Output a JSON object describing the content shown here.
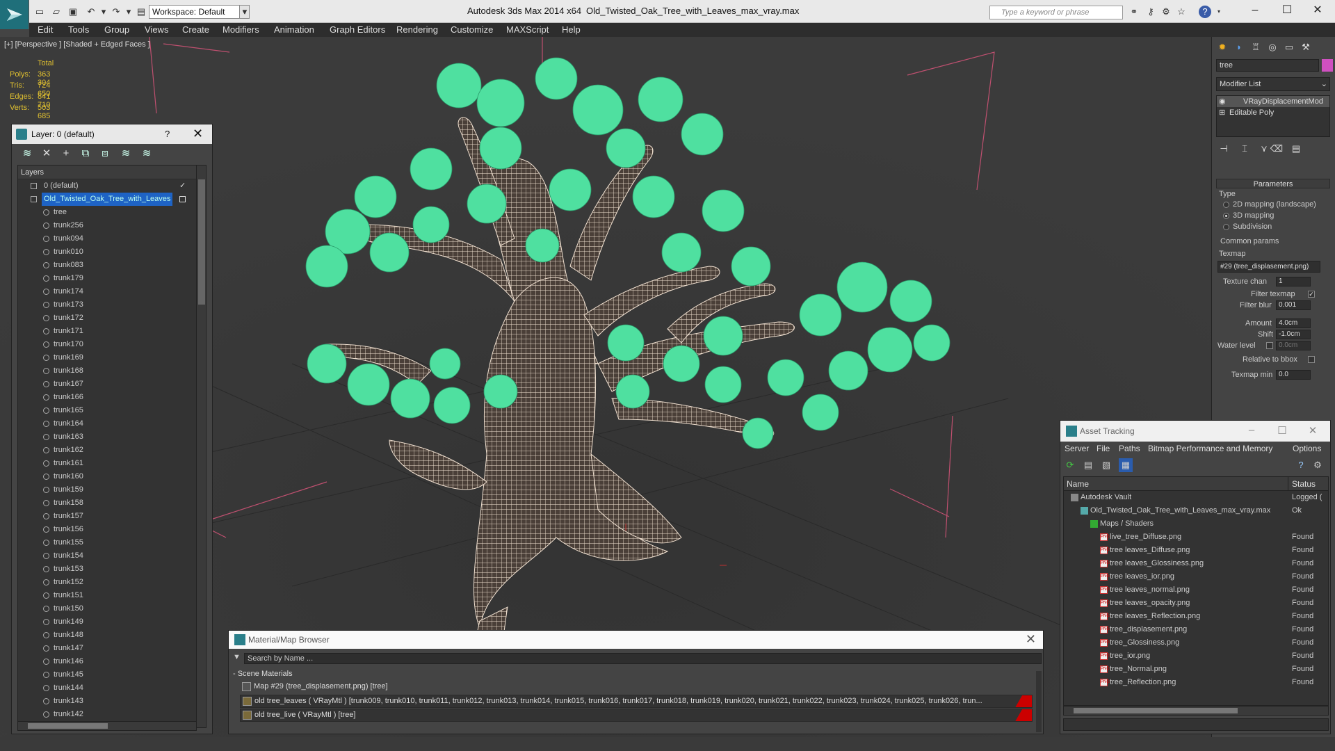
{
  "titlebar": {
    "workspace": "Workspace: Default",
    "app_title": "Autodesk 3ds Max  2014 x64",
    "file_title": "Old_Twisted_Oak_Tree_with_Leaves_max_vray.max",
    "search_placeholder": "Type a keyword or phrase"
  },
  "menu": [
    "Edit",
    "Tools",
    "Group",
    "Views",
    "Create",
    "Modifiers",
    "Animation",
    "Graph Editors",
    "Rendering",
    "Customize",
    "MAXScript",
    "Help"
  ],
  "viewport": {
    "label": "[+] [Perspective ] [Shaded + Edged Faces ]",
    "stats": {
      "header": "Total",
      "polys_label": "Polys:",
      "polys": "363 304",
      "tris_label": "Tris:",
      "tris": "724 650",
      "edges_label": "Edges:",
      "edges": "841 710",
      "verts_label": "Verts:",
      "verts": "503 685"
    },
    "foliage_color": "#4fe0a0",
    "wire_color": "#f0e0d0"
  },
  "layer_panel": {
    "title": "Layer: 0 (default)",
    "help": "?",
    "column": "Layers",
    "layers": [
      {
        "name": "0 (default)",
        "level": 0,
        "selected": false
      },
      {
        "name": "Old_Twisted_Oak_Tree_with_Leaves",
        "level": 0,
        "selected": true
      },
      {
        "name": "tree",
        "level": 1
      },
      {
        "name": "trunk256",
        "level": 1
      },
      {
        "name": "trunk094",
        "level": 1
      },
      {
        "name": "trunk010",
        "level": 1
      },
      {
        "name": "trunk083",
        "level": 1
      },
      {
        "name": "trunk179",
        "level": 1
      },
      {
        "name": "trunk174",
        "level": 1
      },
      {
        "name": "trunk173",
        "level": 1
      },
      {
        "name": "trunk172",
        "level": 1
      },
      {
        "name": "trunk171",
        "level": 1
      },
      {
        "name": "trunk170",
        "level": 1
      },
      {
        "name": "trunk169",
        "level": 1
      },
      {
        "name": "trunk168",
        "level": 1
      },
      {
        "name": "trunk167",
        "level": 1
      },
      {
        "name": "trunk166",
        "level": 1
      },
      {
        "name": "trunk165",
        "level": 1
      },
      {
        "name": "trunk164",
        "level": 1
      },
      {
        "name": "trunk163",
        "level": 1
      },
      {
        "name": "trunk162",
        "level": 1
      },
      {
        "name": "trunk161",
        "level": 1
      },
      {
        "name": "trunk160",
        "level": 1
      },
      {
        "name": "trunk159",
        "level": 1
      },
      {
        "name": "trunk158",
        "level": 1
      },
      {
        "name": "trunk157",
        "level": 1
      },
      {
        "name": "trunk156",
        "level": 1
      },
      {
        "name": "trunk155",
        "level": 1
      },
      {
        "name": "trunk154",
        "level": 1
      },
      {
        "name": "trunk153",
        "level": 1
      },
      {
        "name": "trunk152",
        "level": 1
      },
      {
        "name": "trunk151",
        "level": 1
      },
      {
        "name": "trunk150",
        "level": 1
      },
      {
        "name": "trunk149",
        "level": 1
      },
      {
        "name": "trunk148",
        "level": 1
      },
      {
        "name": "trunk147",
        "level": 1
      },
      {
        "name": "trunk146",
        "level": 1
      },
      {
        "name": "trunk145",
        "level": 1
      },
      {
        "name": "trunk144",
        "level": 1
      },
      {
        "name": "trunk143",
        "level": 1
      },
      {
        "name": "trunk142",
        "level": 1
      }
    ]
  },
  "command_panel": {
    "object_name": "tree",
    "object_color": "#d050c0",
    "modifier_list": "Modifier List",
    "stack": [
      "VRayDisplacementMod",
      "Editable Poly"
    ],
    "parameters": "Parameters",
    "type_label": "Type",
    "type_options": [
      {
        "label": "2D mapping (landscape)",
        "on": false
      },
      {
        "label": "3D mapping",
        "on": true
      },
      {
        "label": "Subdivision",
        "on": false
      }
    ],
    "common_params": "Common params",
    "texmap_label": "Texmap",
    "texmap_value": "#29 (tree_displasement.png)",
    "texture_chan_label": "Texture chan",
    "texture_chan": "1",
    "filter_texmap_label": "Filter texmap",
    "filter_blur_label": "Filter blur",
    "filter_blur": "0.001",
    "amount_label": "Amount",
    "amount": "4.0cm",
    "shift_label": "Shift",
    "shift": "-1.0cm",
    "water_level_label": "Water level",
    "water_level": "0.0cm",
    "relative_bbox_label": "Relative to bbox",
    "texmap_min_label": "Texmap min",
    "texmap_min": "0.0"
  },
  "material_browser": {
    "title": "Material/Map Browser",
    "search_placeholder": "Search by Name ...",
    "group": "- Scene Materials",
    "rows": [
      "Map #29 (tree_displasement.png)  [tree]",
      "old tree_leaves  ( VRayMtl )  [trunk009, trunk010, trunk011, trunk012, trunk013, trunk014, trunk015, trunk016, trunk017, trunk018, trunk019, trunk020, trunk021, trunk022, trunk023, trunk024, trunk025, trunk026, trun...",
      "old tree_live  ( VRayMtl )  [tree]"
    ]
  },
  "asset_tracking": {
    "title": "Asset Tracking",
    "menu": [
      "Server",
      "File",
      "Paths",
      "Bitmap Performance and Memory",
      "Options"
    ],
    "col_name": "Name",
    "col_status": "Status",
    "rows": [
      {
        "name": "Autodesk Vault",
        "status": "Logged (",
        "level": 0,
        "icon": "vault"
      },
      {
        "name": "Old_Twisted_Oak_Tree_with_Leaves_max_vray.max",
        "status": "Ok",
        "level": 1,
        "icon": "max"
      },
      {
        "name": "Maps / Shaders",
        "status": "",
        "level": 2,
        "icon": "maps"
      },
      {
        "name": "live_tree_Diffuse.png",
        "status": "Found",
        "level": 3,
        "icon": "png"
      },
      {
        "name": "tree leaves_Diffuse.png",
        "status": "Found",
        "level": 3,
        "icon": "png"
      },
      {
        "name": "tree leaves_Glossiness.png",
        "status": "Found",
        "level": 3,
        "icon": "png"
      },
      {
        "name": "tree leaves_ior.png",
        "status": "Found",
        "level": 3,
        "icon": "png"
      },
      {
        "name": "tree leaves_normal.png",
        "status": "Found",
        "level": 3,
        "icon": "png"
      },
      {
        "name": "tree leaves_opacity.png",
        "status": "Found",
        "level": 3,
        "icon": "png"
      },
      {
        "name": "tree leaves_Reflection.png",
        "status": "Found",
        "level": 3,
        "icon": "png"
      },
      {
        "name": "tree_displasement.png",
        "status": "Found",
        "level": 3,
        "icon": "png"
      },
      {
        "name": "tree_Glossiness.png",
        "status": "Found",
        "level": 3,
        "icon": "png"
      },
      {
        "name": "tree_ior.png",
        "status": "Found",
        "level": 3,
        "icon": "png"
      },
      {
        "name": "tree_Normal.png",
        "status": "Found",
        "level": 3,
        "icon": "png"
      },
      {
        "name": "tree_Reflection.png",
        "status": "Found",
        "level": 3,
        "icon": "png"
      }
    ]
  }
}
